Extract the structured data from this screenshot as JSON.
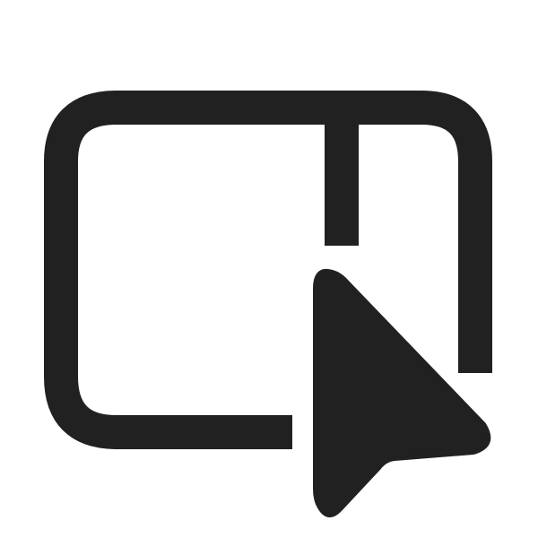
{
  "icon": {
    "name": "window-split-cursor-icon",
    "color": "#212121",
    "background": "#ffffff"
  }
}
